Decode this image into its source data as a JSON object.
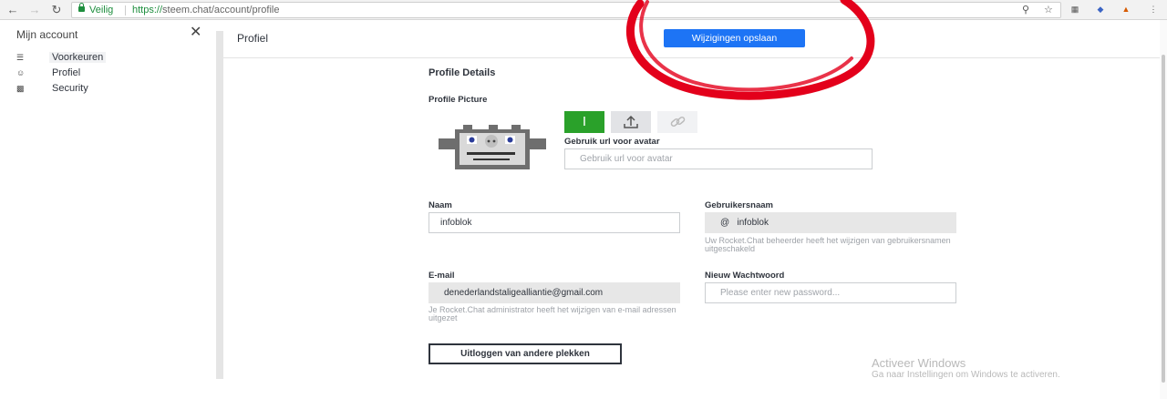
{
  "browser": {
    "back_icon": "arrow-left-icon",
    "forward_icon": "arrow-right-icon",
    "reload_icon": "reload-icon",
    "secure_label": "Veilig",
    "url_scheme": "https://",
    "url_host": "steem.chat",
    "url_path": "/account/profile"
  },
  "sidebar": {
    "title": "Mijn account",
    "items": [
      {
        "label": "Voorkeuren",
        "icon": "sliders-icon"
      },
      {
        "label": "Profiel",
        "icon": "user-icon"
      },
      {
        "label": "Security",
        "icon": "lock-icon"
      }
    ]
  },
  "header": {
    "title": "Profiel",
    "save_label": "Wijzigingen opslaan"
  },
  "profile": {
    "section_title": "Profile Details",
    "picture_label": "Profile Picture",
    "initial_label": "I",
    "avatar_url_label": "Gebruik url voor avatar",
    "avatar_url_placeholder": "Gebruik url voor avatar",
    "name_label": "Naam",
    "name_value": "infoblok",
    "username_label": "Gebruikersnaam",
    "username_prefix": "@",
    "username_value": "infoblok",
    "username_hint": "Uw Rocket.Chat beheerder heeft het wijzigen van gebruikersnamen uitgeschakeld",
    "email_label": "E-mail",
    "email_value": "denederlandstaligealliantie@gmail.com",
    "email_hint": "Je Rocket.Chat administrator heeft het wijzigen van e-mail adressen uitgezet",
    "password_label": "Nieuw Wachtwoord",
    "password_placeholder": "Please enter new password...",
    "logout_label": "Uitloggen van andere plekken"
  },
  "watermark": {
    "title": "Activeer Windows",
    "subtitle": "Ga naar Instellingen om Windows te activeren."
  },
  "colors": {
    "primary": "#1d74f5",
    "green": "#2aa12a",
    "annotation": "#e3001b"
  }
}
